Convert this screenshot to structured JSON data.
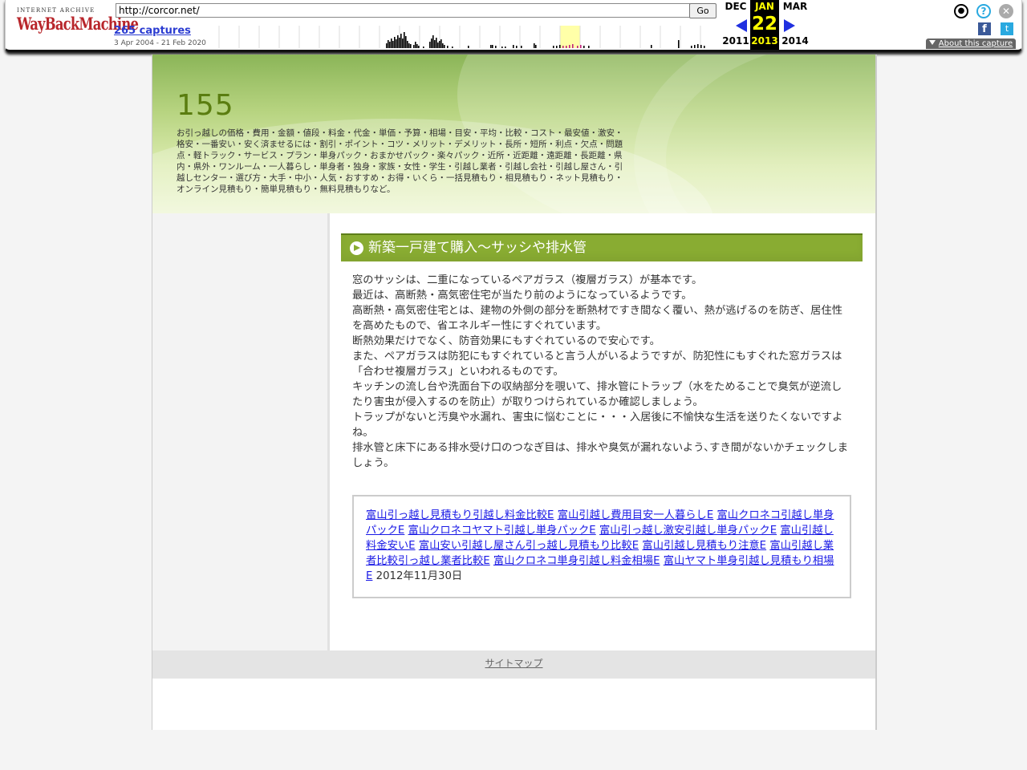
{
  "wayback": {
    "logo_top": "INTERNET ARCHIVE",
    "logo_main": "WayBackMachine",
    "url": "http://corcor.net/",
    "go_label": "Go",
    "captures_label": "265 captures",
    "date_range": "3 Apr 2004 - 21 Feb 2020",
    "prev": {
      "month": "DEC",
      "year": "2011"
    },
    "current": {
      "month": "JAN",
      "day": "22",
      "year": "2013"
    },
    "next": {
      "month": "MAR",
      "year": "2014"
    },
    "about_label": "About this capture",
    "facebook_glyph": "f",
    "twitter_glyph": "t",
    "help_glyph": "?",
    "close_glyph": "✕",
    "user_glyph": "●"
  },
  "site": {
    "title": "155",
    "description": "お引っ越しの価格・費用・金額・値段・料金・代金・単価・予算・相場・目安・平均・比較・コスト・最安値・激安・格安・一番安い・安く済ませるには・割引・ポイント・コツ・メリット・デメリット・長所・短所・利点・欠点・問題点・軽トラック・サービス・プラン・単身パック・おまかせパック・楽々パック・近所・近距離・遠距離・長距離・県内・県外・ワンルーム・一人暮らし・単身者・独身・家族・女性・学生・引越し業者・引越し会社・引越し屋さん・引越しセンター・選び方・大手・中小・人気・おすすめ・お得・いくら・一括見積もり・相見積もり・ネット見積もり・オンライン見積もり・簡単見積もり・無料見積もりなど。"
  },
  "post": {
    "title": "新築一戸建て購入～サッシや排水管",
    "paragraphs": [
      "窓のサッシは、二重になっているペアガラス（複層ガラス）が基本です。",
      "最近は、高断熱・高気密住宅が当たり前のようになっているようです。",
      "高断熱・高気密住宅とは、建物の外側の部分を断熱材ですき間なく覆い、熱が逃げるのを防ぎ、居住性を高めたもので、省エネルギー性にすぐれています。",
      "断熱効果だけでなく、防音効果にもすぐれているので安心です。",
      "また、ペアガラスは防犯にもすぐれていると言う人がいるようですが、防犯性にもすぐれた窓ガラスは「合わせ複層ガラス」といわれるものです。",
      "キッチンの流し台や洗面台下の収納部分を覗いて、排水管にトラップ（水をためることで臭気が逆流したり害虫が侵入するのを防止）が取りつけられているか確認しましょう。",
      "トラップがないと汚臭や水漏れ、害虫に悩むことに・・・入居後に不愉快な生活を送りたくないですよね。",
      "排水管と床下にある排水受け口のつなぎ目は、排水や臭気が漏れないよう､すき間がないかチェックしましょう。"
    ],
    "links": [
      "富山引っ越し見積もり引越し料金比較E",
      "富山引越し費用目安一人暮らしE",
      "富山クロネコ引越し単身パックE",
      "富山クロネコヤマト引越し単身パックE",
      "富山引っ越し激安引越し単身パックE",
      "富山引越し料金安いE",
      "富山安い引越し屋さん引っ越し見積もり比較E",
      "富山引越し見積もり注意E",
      "富山引越し業者比較引っ越し業者比較E",
      "富山クロネコ単身引越し料金相場E",
      "富山ヤマト単身引越し見積もり相場E"
    ],
    "date": "2012年11月30日"
  },
  "footer": {
    "sitemap_label": "サイトマップ"
  },
  "colors": {
    "accent_green": "#89ac32",
    "title_green": "#5a7d10",
    "link_blue": "#1a1ae6",
    "wayback_red": "#b8262b"
  },
  "capture_histogram": [
    0,
    0,
    0,
    0,
    0,
    0,
    0,
    0,
    0,
    0,
    0,
    0,
    0,
    0,
    0,
    0,
    0,
    0,
    0,
    0,
    0,
    0,
    0,
    0,
    0,
    0,
    0,
    0,
    0,
    0,
    0,
    0,
    0,
    0,
    0,
    0,
    0,
    0,
    0,
    0,
    0,
    0,
    0,
    0,
    0,
    0,
    0,
    0,
    0,
    0,
    0,
    0,
    0,
    0,
    0,
    0,
    0,
    0,
    0,
    0,
    0,
    0,
    0,
    0,
    0,
    0,
    0,
    0,
    0,
    0,
    0,
    0,
    0,
    0,
    0,
    0,
    0,
    0,
    0,
    0,
    0,
    0,
    0,
    0,
    0,
    0,
    0,
    0,
    0,
    0,
    0,
    0,
    0,
    0,
    0,
    0,
    0,
    0,
    0,
    0,
    0,
    0,
    0,
    0,
    0,
    0,
    0,
    0,
    0,
    0,
    0,
    0,
    0,
    0,
    0,
    0,
    0,
    0,
    0,
    0,
    0,
    0,
    0,
    0,
    0,
    0,
    0,
    0,
    0,
    0,
    0,
    0,
    0,
    0,
    0,
    0,
    0,
    0,
    0,
    0,
    0,
    0,
    0,
    0,
    0,
    0,
    0,
    0,
    0,
    0,
    0,
    0,
    0,
    0,
    0,
    0,
    0,
    0,
    0,
    0,
    0,
    0,
    0,
    0,
    0,
    0,
    0,
    0,
    0,
    0,
    0,
    0,
    0,
    0,
    0,
    0,
    0,
    0,
    0,
    0,
    0,
    0,
    0,
    0,
    0,
    0,
    0,
    0,
    0,
    0,
    0,
    0,
    0,
    0,
    0,
    0,
    0,
    0,
    0,
    0,
    0,
    0,
    0,
    0,
    0,
    0,
    0,
    0,
    0,
    0,
    0,
    0,
    0,
    0,
    0,
    0,
    0,
    0,
    0,
    0,
    0,
    0,
    0,
    0,
    0,
    0,
    0,
    0,
    0,
    0,
    0,
    0,
    0,
    0,
    0,
    0,
    0,
    0,
    0,
    0,
    0,
    0,
    0,
    0,
    0,
    0,
    0,
    0,
    0,
    0,
    0,
    0,
    0,
    0,
    0,
    0,
    0,
    0,
    0,
    0,
    0,
    0,
    0,
    0,
    0,
    0,
    0,
    0,
    0,
    0,
    0,
    0,
    0,
    0,
    0,
    0,
    0,
    0,
    0,
    0,
    0,
    0,
    0,
    0,
    0,
    0,
    0,
    0,
    0,
    0,
    0,
    0,
    0,
    0,
    0,
    0,
    0,
    0,
    0,
    0,
    0,
    0,
    0,
    0,
    0,
    0,
    0,
    0,
    0,
    0,
    0,
    0,
    0,
    0,
    0,
    0,
    0,
    0,
    0,
    0,
    0,
    0,
    0,
    0,
    0,
    0,
    0,
    0,
    0,
    0,
    0,
    0,
    0,
    0,
    0,
    0,
    0,
    0,
    0,
    0,
    0,
    0,
    0,
    0,
    0,
    0,
    0,
    0,
    0,
    0,
    0,
    0,
    0,
    0,
    0,
    0,
    0,
    0,
    0,
    0,
    0,
    0,
    0,
    0,
    0,
    0,
    0,
    0,
    0,
    0,
    0,
    0,
    0,
    0,
    0,
    0,
    0,
    0,
    0,
    0,
    0,
    0,
    0,
    0,
    0,
    0,
    0,
    0,
    0,
    0,
    0,
    0,
    0,
    0,
    0,
    0,
    0,
    0,
    0,
    0,
    0,
    0,
    0,
    0,
    0,
    0,
    0,
    0,
    0,
    0,
    0,
    0,
    0,
    0,
    0,
    0,
    0,
    0,
    0,
    0,
    0,
    0,
    0,
    0,
    0,
    0,
    0,
    0,
    0,
    0,
    0,
    0,
    0,
    0,
    0,
    0,
    0,
    0,
    0,
    0,
    0,
    0,
    0,
    0,
    0,
    0,
    0,
    0,
    0,
    0,
    0,
    0,
    0,
    0,
    0,
    0,
    0,
    0,
    0,
    0,
    0,
    0,
    0,
    0,
    0,
    0,
    0,
    0,
    0,
    0,
    0,
    0,
    0,
    0,
    0,
    0,
    0,
    0,
    0,
    0,
    0,
    0,
    0,
    0,
    0,
    0,
    0,
    0,
    0,
    0,
    0,
    0,
    0,
    0,
    0,
    0,
    0,
    0,
    0,
    0,
    0,
    0,
    0,
    0,
    0,
    0,
    0,
    0,
    0,
    0,
    0,
    0,
    0,
    0,
    0,
    0,
    0,
    0,
    0,
    0,
    0,
    0,
    0,
    0,
    0,
    0,
    0,
    0,
    0,
    0,
    0,
    0,
    0,
    0,
    0,
    0,
    0,
    0,
    0,
    0,
    0,
    0,
    0,
    0,
    0,
    0,
    0,
    0,
    0,
    0,
    0,
    0,
    0,
    0,
    0,
    0,
    0,
    0,
    0,
    0,
    0,
    0,
    0,
    0,
    0,
    0,
    0,
    0,
    0,
    0,
    0,
    0,
    0,
    0,
    0,
    0,
    0,
    0,
    0,
    0,
    0,
    0,
    0,
    0,
    0,
    0,
    0,
    0,
    0,
    0,
    0,
    0,
    0,
    0,
    0,
    0,
    0,
    0,
    0,
    0,
    0,
    0,
    0,
    0,
    0,
    0,
    0,
    0,
    0,
    0,
    0,
    0,
    0,
    0,
    0,
    0,
    0,
    0,
    0,
    0,
    0,
    0,
    0,
    0,
    0,
    0,
    0,
    0,
    0,
    0,
    0,
    0,
    0,
    0,
    0,
    0,
    0,
    0,
    0,
    0,
    0,
    0,
    0,
    0,
    0,
    0,
    0,
    0,
    0,
    0,
    0,
    0,
    0,
    0,
    0,
    0,
    0,
    0,
    0,
    0,
    0,
    0,
    0,
    0,
    0,
    0,
    0,
    0,
    0,
    0,
    0,
    0,
    0
  ]
}
